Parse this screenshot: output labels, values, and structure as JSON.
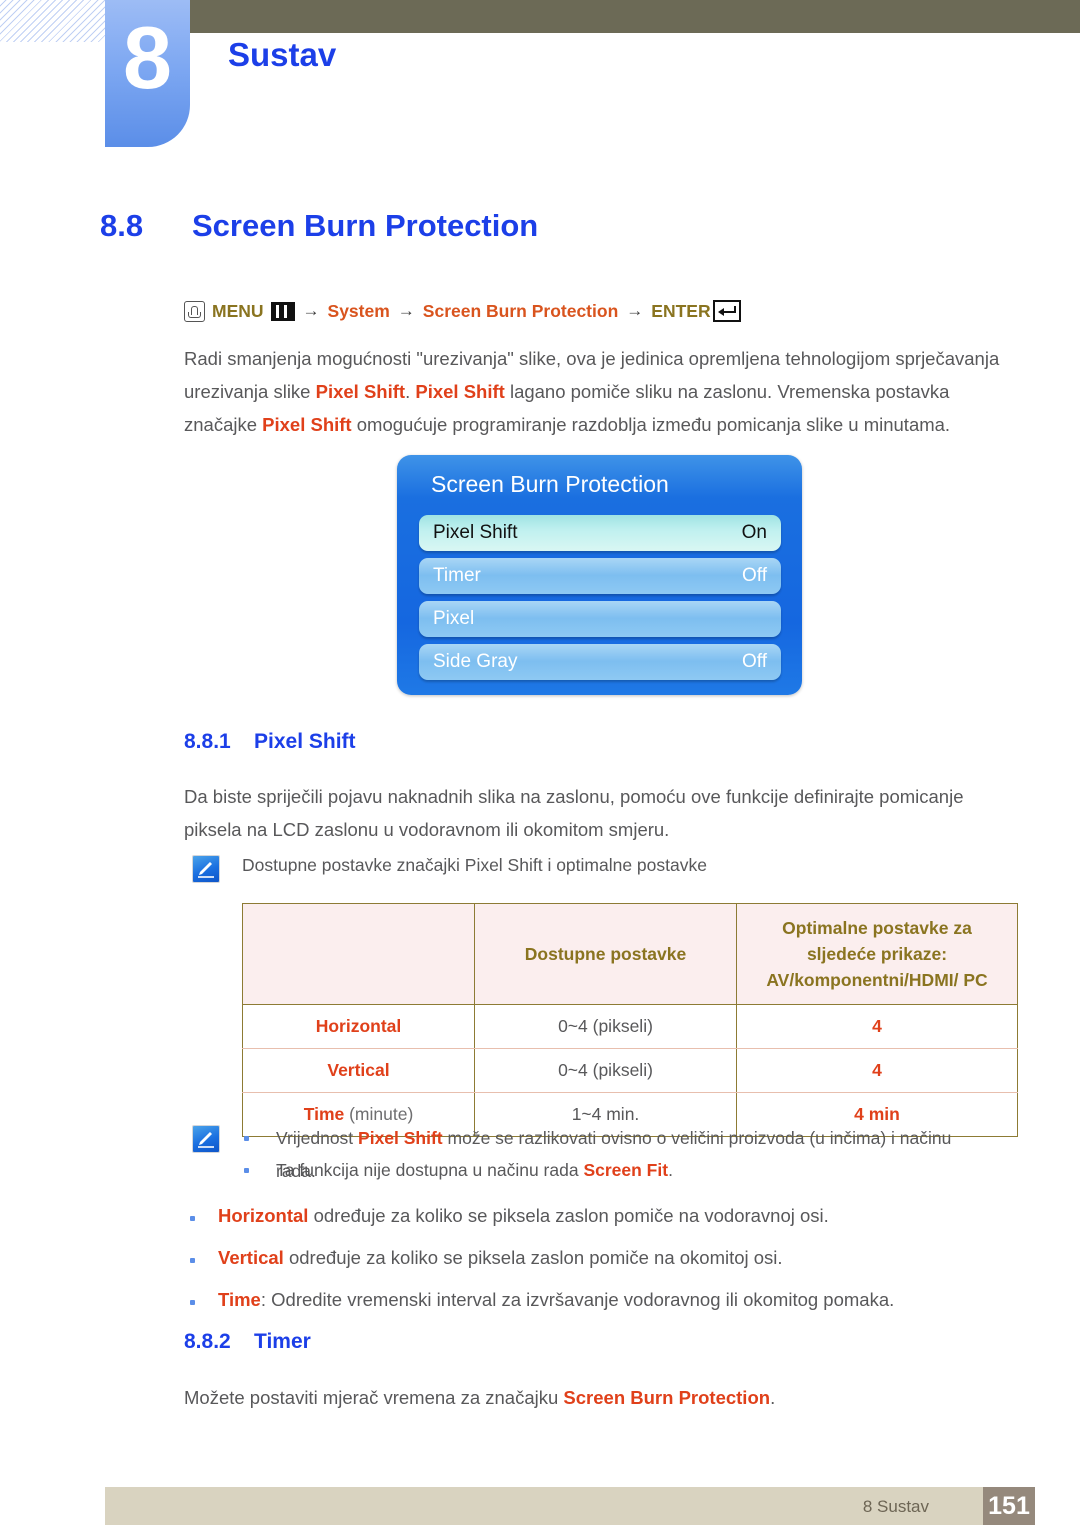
{
  "header": {
    "chapter_number": "8",
    "chapter_title": "Sustav"
  },
  "section": {
    "number": "8.8",
    "title": "Screen Burn Protection"
  },
  "menu_path": {
    "hand_icon": "hand-click-icon",
    "menu_label": "MENU",
    "menu_icon": "menu-bars-icon",
    "arrow": "→",
    "item1": "System",
    "item2": "Screen Burn Protection",
    "enter_label": "ENTER",
    "enter_icon": "enter-return-icon"
  },
  "intro": {
    "p1_a": "Radi smanjenja mogućnosti \"urezivanja\" slike, ova je jedinica opremljena tehnologijom sprječavanja urezivanja slike ",
    "p1_hl1": "Pixel Shift",
    "p1_b": ". ",
    "p1_hl2": "Pixel Shift",
    "p1_c": " lagano pomiče sliku na zaslonu. Vremenska postavka značajke ",
    "p1_hl3": "Pixel Shift",
    "p1_d": " omogućuje programiranje razdoblja između pomicanja slike u minutama."
  },
  "osd": {
    "title": "Screen Burn Protection",
    "rows": [
      {
        "label": "Pixel Shift",
        "value": "On",
        "selected": true
      },
      {
        "label": "Timer",
        "value": "Off",
        "selected": false
      },
      {
        "label": "Pixel",
        "value": "",
        "selected": false
      },
      {
        "label": "Side Gray",
        "value": "Off",
        "selected": false
      }
    ]
  },
  "subsection1": {
    "number": "8.8.1",
    "title": "Pixel Shift",
    "paragraph": "Da biste spriječili pojavu naknadnih slika na zaslonu, pomoću ove funkcije definirajte pomicanje piksela na LCD zaslonu u vodoravnom ili okomitom smjeru.",
    "note_icon": "note-pencil-icon",
    "note_text": "Dostupne postavke značajki Pixel Shift i optimalne postavke"
  },
  "table": {
    "headers": [
      "",
      "Dostupne postavke",
      "Optimalne postavke za sljedeće prikaze: AV/komponentni/HDMI/ PC"
    ],
    "rows": [
      {
        "key": "Horizontal",
        "key_sub": "",
        "available": "0~4 (pikseli)",
        "optimal": "4"
      },
      {
        "key": "Vertical",
        "key_sub": "",
        "available": "0~4 (pikseli)",
        "optimal": "4"
      },
      {
        "key": "Time",
        "key_sub": " (minute)",
        "available": "1~4 min.",
        "optimal": "4 min"
      }
    ]
  },
  "note_block": {
    "note_icon": "note-pencil-icon",
    "items": [
      {
        "a": "Vrijednost ",
        "hl": "Pixel Shift",
        "b": " može se razlikovati ovisno o veličini proizvoda (u inčima) i načinu rada."
      },
      {
        "a": "Ta funkcija nije dostupna u načinu rada ",
        "hl": "Screen Fit",
        "b": "."
      }
    ]
  },
  "bullets": [
    {
      "hl": "Horizontal",
      "rest": " određuje za koliko se piksela zaslon pomiče na vodoravnoj osi."
    },
    {
      "hl": "Vertical",
      "rest": " određuje za koliko se piksela zaslon pomiče na okomitoj osi."
    },
    {
      "hl": "Time",
      "rest": ": Odredite vremenski interval za izvršavanje vodoravnog ili okomitog pomaka."
    }
  ],
  "subsection2": {
    "number": "8.8.2",
    "title": "Timer",
    "p_a": "Možete postaviti mjerač vremena za značajku ",
    "p_hl": "Screen Burn Protection",
    "p_b": "."
  },
  "footer": {
    "label": "8 Sustav",
    "page": "151"
  },
  "colors": {
    "accent_blue": "#1c3fe8",
    "highlight_orange": "#e0401a",
    "olive": "#6c6a56",
    "table_header_text": "#8a7420",
    "footer_bar": "#d9d3c0",
    "footer_page_box": "#95897c"
  }
}
